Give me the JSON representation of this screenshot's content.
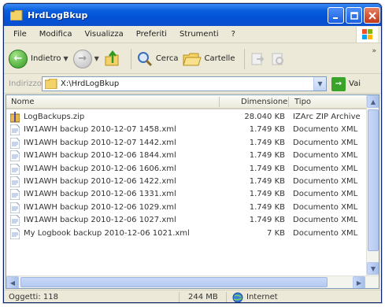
{
  "window": {
    "title": "HrdLogBkup"
  },
  "menu": {
    "items": [
      "File",
      "Modifica",
      "Visualizza",
      "Preferiti",
      "Strumenti",
      "?"
    ]
  },
  "toolbar": {
    "back_label": "Indietro",
    "search_label": "Cerca",
    "folders_label": "Cartelle"
  },
  "address": {
    "label": "Indirizzo",
    "path": "X:\\HrdLogBkup",
    "go_label": "Vai"
  },
  "columns": {
    "name": "Nome",
    "size": "Dimensione",
    "type": "Tipo"
  },
  "files": [
    {
      "name": "LogBackups.zip",
      "size": "28.040 KB",
      "type": "IZArc ZIP Archive",
      "icon": "zip-archive-icon"
    },
    {
      "name": "IW1AWH backup 2010-12-07 1458.xml",
      "size": "1.749 KB",
      "type": "Documento XML",
      "icon": "xml-document-icon"
    },
    {
      "name": "IW1AWH backup 2010-12-07 1442.xml",
      "size": "1.749 KB",
      "type": "Documento XML",
      "icon": "xml-document-icon"
    },
    {
      "name": "IW1AWH backup 2010-12-06 1844.xml",
      "size": "1.749 KB",
      "type": "Documento XML",
      "icon": "xml-document-icon"
    },
    {
      "name": "IW1AWH backup 2010-12-06 1606.xml",
      "size": "1.749 KB",
      "type": "Documento XML",
      "icon": "xml-document-icon"
    },
    {
      "name": "IW1AWH backup 2010-12-06 1422.xml",
      "size": "1.749 KB",
      "type": "Documento XML",
      "icon": "xml-document-icon"
    },
    {
      "name": "IW1AWH backup 2010-12-06 1331.xml",
      "size": "1.749 KB",
      "type": "Documento XML",
      "icon": "xml-document-icon"
    },
    {
      "name": "IW1AWH backup 2010-12-06 1029.xml",
      "size": "1.749 KB",
      "type": "Documento XML",
      "icon": "xml-document-icon"
    },
    {
      "name": "IW1AWH backup 2010-12-06 1027.xml",
      "size": "1.749 KB",
      "type": "Documento XML",
      "icon": "xml-document-icon"
    },
    {
      "name": "My Logbook backup 2010-12-06 1021.xml",
      "size": "7 KB",
      "type": "Documento XML",
      "icon": "xml-document-icon"
    }
  ],
  "status": {
    "objects": "Oggetti: 118",
    "size": "244 MB",
    "zone": "Internet"
  }
}
